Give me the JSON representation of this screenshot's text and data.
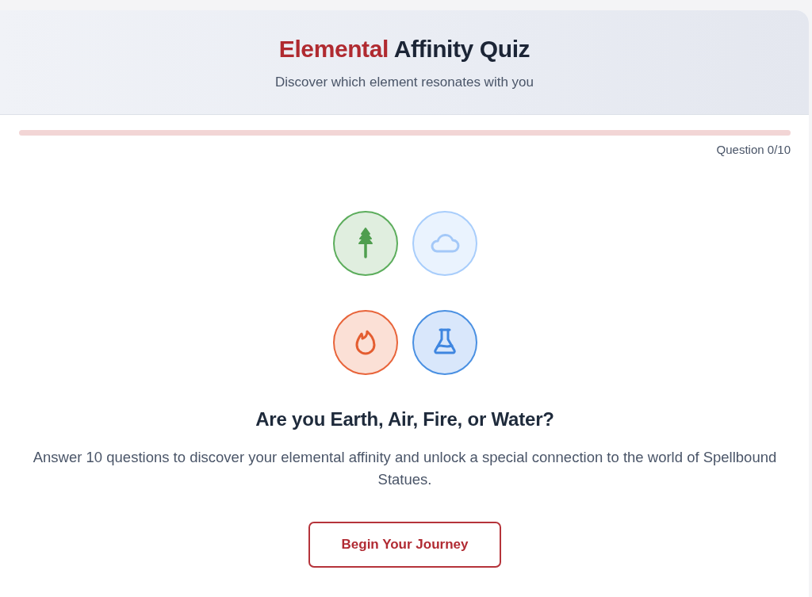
{
  "header": {
    "title_accent": "Elemental",
    "title_rest": "Affinity Quiz",
    "subtitle": "Discover which element resonates with you"
  },
  "progress": {
    "label": "Question 0/10"
  },
  "intro": {
    "heading": "Are you Earth, Air, Fire, or Water?",
    "text": "Answer 10 questions to discover your elemental affinity and unlock a special connection to the world of Spellbound Statues.",
    "button": "Begin Your Journey"
  }
}
